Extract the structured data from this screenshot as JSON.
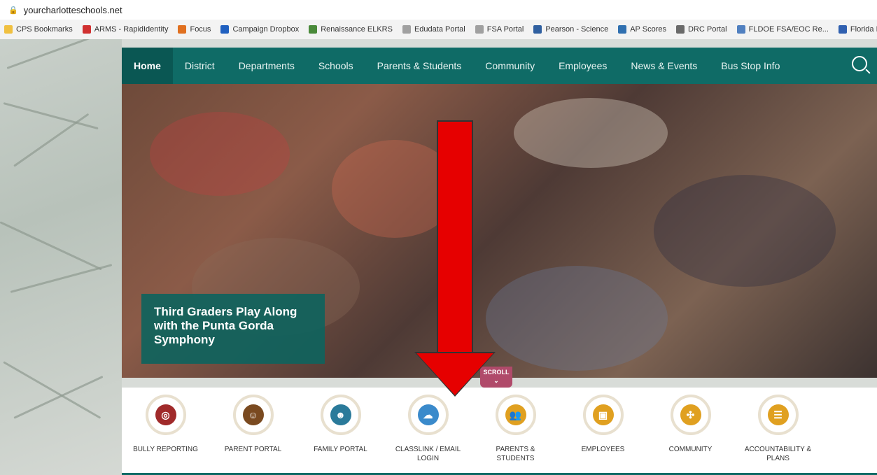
{
  "browser": {
    "url": "yourcharlotteschools.net",
    "bookmarks": [
      {
        "label": "CPS Bookmarks",
        "color": "#f0c040"
      },
      {
        "label": "ARMS - RapidIdentity",
        "color": "#d03030"
      },
      {
        "label": "Focus",
        "color": "#e07020"
      },
      {
        "label": "Campaign Dropbox",
        "color": "#2060c0"
      },
      {
        "label": "Renaissance ELKRS",
        "color": "#4a8a3a"
      },
      {
        "label": "Edudata Portal",
        "color": "#a0a0a0"
      },
      {
        "label": "FSA Portal",
        "color": "#a0a0a0"
      },
      {
        "label": "Pearson - Science",
        "color": "#3060a0"
      },
      {
        "label": "AP Scores",
        "color": "#3070b0"
      },
      {
        "label": "DRC Portal",
        "color": "#6a6a6a"
      },
      {
        "label": "FLDOE FSA/EOC Re...",
        "color": "#5080c0"
      },
      {
        "label": "Florida K-Readiness",
        "color": "#3060b0"
      }
    ]
  },
  "nav": {
    "items": [
      "Home",
      "District",
      "Departments",
      "Schools",
      "Parents & Students",
      "Community",
      "Employees",
      "News & Events",
      "Bus Stop Info"
    ],
    "active": "Home"
  },
  "hero": {
    "caption": "Third Graders Play Along with the Punta Gorda Symphony",
    "scroll_label": "SCROLL",
    "prev": "‹",
    "pause": "II",
    "next": "›"
  },
  "quicklinks": [
    {
      "label": "BULLY REPORTING",
      "color": "#a02a2a",
      "glyph": "◎"
    },
    {
      "label": "PARENT PORTAL",
      "color": "#7a4a20",
      "glyph": "☺"
    },
    {
      "label": "FAMILY PORTAL",
      "color": "#2a7a9a",
      "glyph": "☻"
    },
    {
      "label": "CLASSLINK / EMAIL LOGIN",
      "color": "#3a8acb",
      "glyph": "☁"
    },
    {
      "label": "PARENTS & STUDENTS",
      "color": "#e0a020",
      "glyph": "👥"
    },
    {
      "label": "EMPLOYEES",
      "color": "#e0a020",
      "glyph": "▣"
    },
    {
      "label": "COMMUNITY",
      "color": "#e0a020",
      "glyph": "✣"
    },
    {
      "label": "ACCOUNTABILITY & PLANS",
      "color": "#e0a020",
      "glyph": "☰"
    }
  ]
}
